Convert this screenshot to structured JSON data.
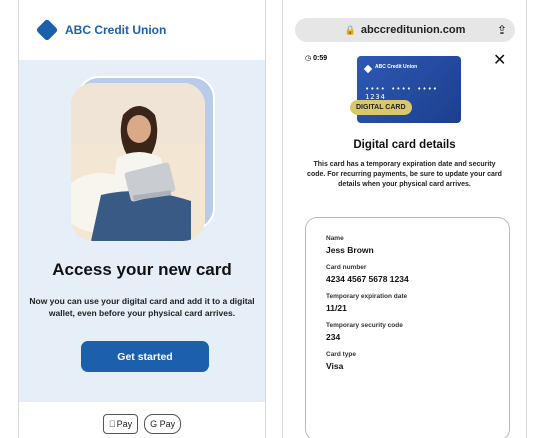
{
  "left_screen": {
    "brand": "ABC Credit Union",
    "headline": "Access your new card",
    "subtext": "Now you can use your digital card and add it to a digital wallet, even before your physical card arrives.",
    "cta_label": "Get started",
    "apple_pay_label": "Pay",
    "google_pay_label": "G Pay"
  },
  "right_screen": {
    "url": "abccreditunion.com",
    "timer": "0:59",
    "card": {
      "brand": "ABC Credit Union",
      "number_mask": "•••• •••• •••• 1234",
      "badge": "DIGITAL CARD"
    },
    "details_title": "Digital card details",
    "details_text": "This card has a temporary expiration date and security code. For recurring payments, be sure to update your card details when your physical card arrives.",
    "fields": [
      {
        "label": "Name",
        "value": "Jess Brown"
      },
      {
        "label": "Card number",
        "value": "4234 4567 5678 1234"
      },
      {
        "label": "Temporary expiration date",
        "value": "11/21"
      },
      {
        "label": "Temporary security code",
        "value": "234"
      },
      {
        "label": "Card type",
        "value": "Visa"
      }
    ]
  },
  "colors": {
    "brand_blue": "#1c5fab",
    "hero_bg": "#e6eef8",
    "badge_gold": "#d9c86a"
  }
}
